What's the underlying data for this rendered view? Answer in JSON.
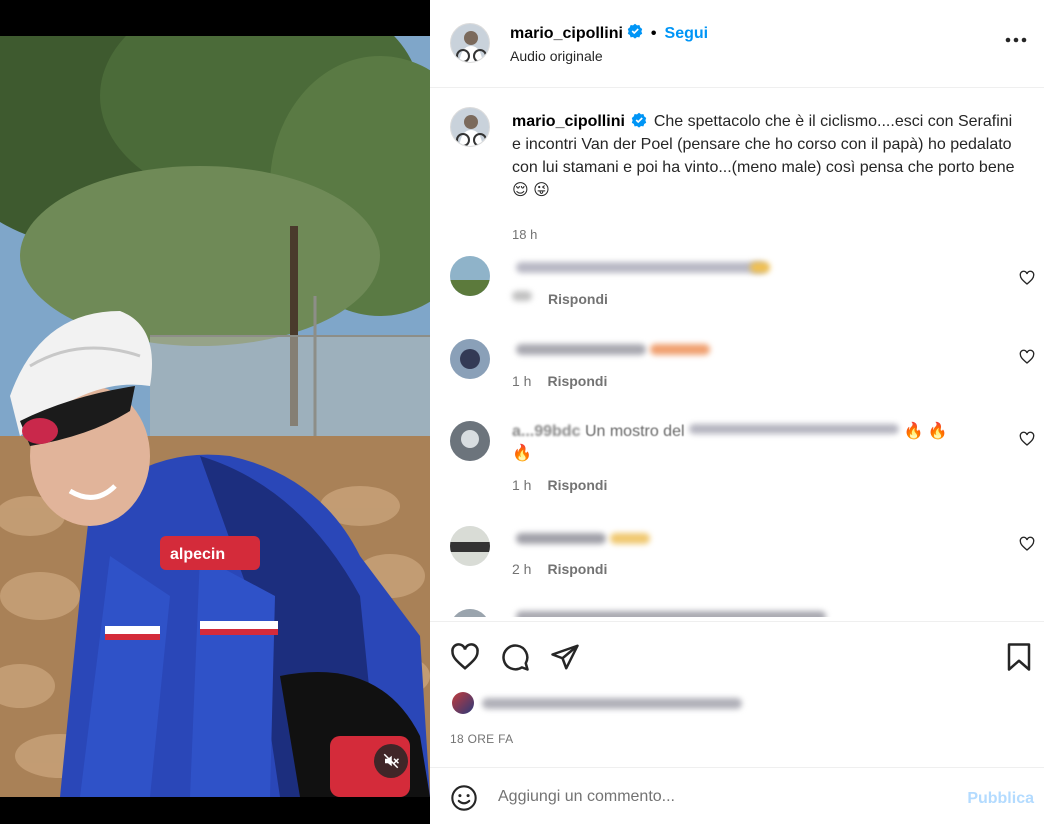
{
  "header": {
    "username": "mario_cipollini",
    "separator": "•",
    "follow_label": "Segui",
    "subtitle": "Audio originale"
  },
  "caption": {
    "username": "mario_cipollini",
    "text": "Che spettacolo che è il ciclismo....esci con Serafini e incontri Van der Poel (pensare che ho corso con il papà) ho pedalato con lui stamani e poi ha vinto...(meno male) così pensa che porto bene 😌 😜",
    "time": "18 h"
  },
  "comments": [
    {
      "time": "",
      "reply_label": "Rispondi",
      "text": ""
    },
    {
      "time": "1 h",
      "reply_label": "Rispondi",
      "text": ""
    },
    {
      "time": "1 h",
      "reply_label": "Rispondi",
      "visible_user_prefix": "a...99bdc",
      "text": "Un mostro del",
      "text_suffix": "🔥 🔥 🔥"
    },
    {
      "time": "2 h",
      "reply_label": "Rispondi",
      "text": ""
    }
  ],
  "actions": {
    "icons": [
      "heart-icon",
      "comment-icon",
      "share-icon",
      "bookmark-icon"
    ],
    "time_label": "18 ORE FA"
  },
  "add_comment": {
    "placeholder": "Aggiungi un commento...",
    "publish_label": "Pubblica"
  },
  "colors": {
    "accent": "#0095f6",
    "publish_disabled": "#b3dbff",
    "secondary_text": "#737373",
    "verified": "#0095f6"
  }
}
